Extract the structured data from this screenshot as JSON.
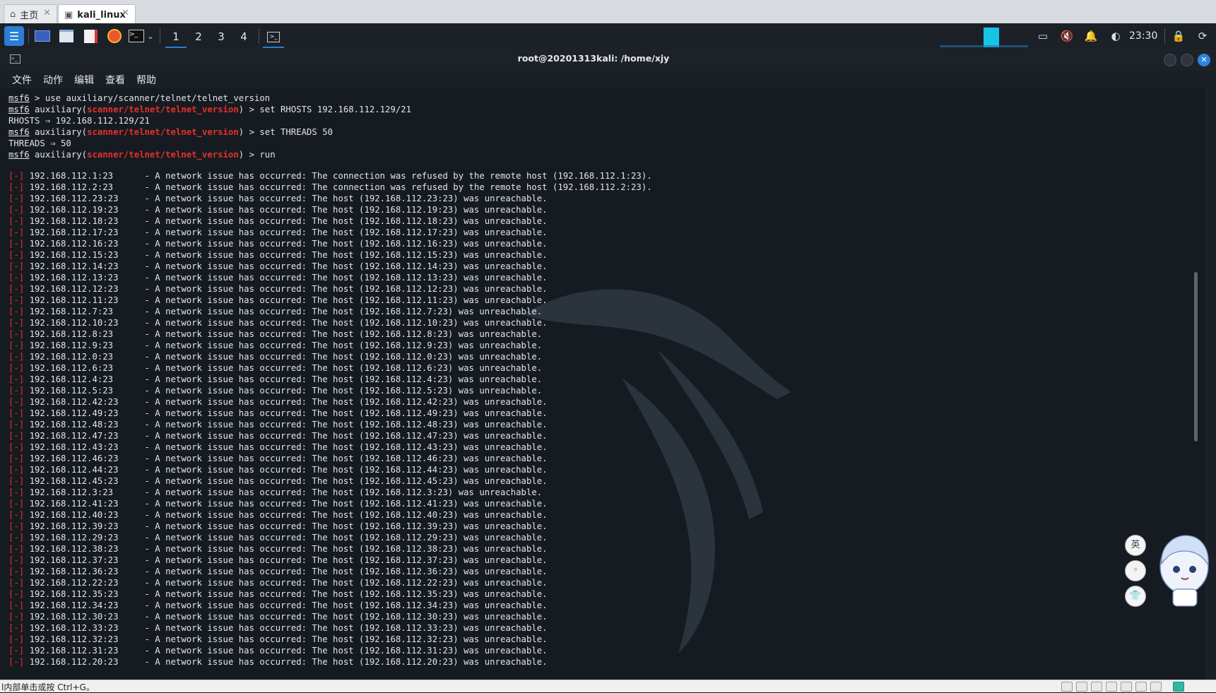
{
  "host_tabs": [
    {
      "label": "主页",
      "icon": "home-icon"
    },
    {
      "label": "kali_linux",
      "icon": "vm-icon"
    }
  ],
  "panel": {
    "workspaces": [
      "1",
      "2",
      "3",
      "4"
    ],
    "clock": "23:30"
  },
  "window": {
    "title": "root@20201313kali: /home/xjy",
    "menu": [
      "文件",
      "动作",
      "编辑",
      "查看",
      "帮助"
    ]
  },
  "terminal": {
    "prompt": "msf6",
    "module": "scanner/telnet/telnet_version",
    "commands": [
      {
        "type": "cmd",
        "text": " > use auxiliary/scanner/telnet/telnet_version"
      },
      {
        "type": "modcmd",
        "text": " > set RHOSTS 192.168.112.129/21"
      },
      {
        "type": "out",
        "text": "RHOSTS ⇒ 192.168.112.129/21"
      },
      {
        "type": "modcmd",
        "text": " > set THREADS 50"
      },
      {
        "type": "out",
        "text": "THREADS ⇒ 50"
      },
      {
        "type": "modcmd",
        "text": " > run"
      }
    ],
    "error_tag": "[-]",
    "results": [
      {
        "host": "192.168.112.1:23",
        "msg": "The connection was refused by the remote host (192.168.112.1:23)."
      },
      {
        "host": "192.168.112.2:23",
        "msg": "The connection was refused by the remote host (192.168.112.2:23)."
      },
      {
        "host": "192.168.112.23:23",
        "msg": "The host (192.168.112.23:23) was unreachable."
      },
      {
        "host": "192.168.112.19:23",
        "msg": "The host (192.168.112.19:23) was unreachable."
      },
      {
        "host": "192.168.112.18:23",
        "msg": "The host (192.168.112.18:23) was unreachable."
      },
      {
        "host": "192.168.112.17:23",
        "msg": "The host (192.168.112.17:23) was unreachable."
      },
      {
        "host": "192.168.112.16:23",
        "msg": "The host (192.168.112.16:23) was unreachable."
      },
      {
        "host": "192.168.112.15:23",
        "msg": "The host (192.168.112.15:23) was unreachable."
      },
      {
        "host": "192.168.112.14:23",
        "msg": "The host (192.168.112.14:23) was unreachable."
      },
      {
        "host": "192.168.112.13:23",
        "msg": "The host (192.168.112.13:23) was unreachable."
      },
      {
        "host": "192.168.112.12:23",
        "msg": "The host (192.168.112.12:23) was unreachable."
      },
      {
        "host": "192.168.112.11:23",
        "msg": "The host (192.168.112.11:23) was unreachable."
      },
      {
        "host": "192.168.112.7:23",
        "msg": "The host (192.168.112.7:23) was unreachable."
      },
      {
        "host": "192.168.112.10:23",
        "msg": "The host (192.168.112.10:23) was unreachable."
      },
      {
        "host": "192.168.112.8:23",
        "msg": "The host (192.168.112.8:23) was unreachable."
      },
      {
        "host": "192.168.112.9:23",
        "msg": "The host (192.168.112.9:23) was unreachable."
      },
      {
        "host": "192.168.112.0:23",
        "msg": "The host (192.168.112.0:23) was unreachable."
      },
      {
        "host": "192.168.112.6:23",
        "msg": "The host (192.168.112.6:23) was unreachable."
      },
      {
        "host": "192.168.112.4:23",
        "msg": "The host (192.168.112.4:23) was unreachable."
      },
      {
        "host": "192.168.112.5:23",
        "msg": "The host (192.168.112.5:23) was unreachable."
      },
      {
        "host": "192.168.112.42:23",
        "msg": "The host (192.168.112.42:23) was unreachable."
      },
      {
        "host": "192.168.112.49:23",
        "msg": "The host (192.168.112.49:23) was unreachable."
      },
      {
        "host": "192.168.112.48:23",
        "msg": "The host (192.168.112.48:23) was unreachable."
      },
      {
        "host": "192.168.112.47:23",
        "msg": "The host (192.168.112.47:23) was unreachable."
      },
      {
        "host": "192.168.112.43:23",
        "msg": "The host (192.168.112.43:23) was unreachable."
      },
      {
        "host": "192.168.112.46:23",
        "msg": "The host (192.168.112.46:23) was unreachable."
      },
      {
        "host": "192.168.112.44:23",
        "msg": "The host (192.168.112.44:23) was unreachable."
      },
      {
        "host": "192.168.112.45:23",
        "msg": "The host (192.168.112.45:23) was unreachable."
      },
      {
        "host": "192.168.112.3:23",
        "msg": "The host (192.168.112.3:23) was unreachable."
      },
      {
        "host": "192.168.112.41:23",
        "msg": "The host (192.168.112.41:23) was unreachable."
      },
      {
        "host": "192.168.112.40:23",
        "msg": "The host (192.168.112.40:23) was unreachable."
      },
      {
        "host": "192.168.112.39:23",
        "msg": "The host (192.168.112.39:23) was unreachable."
      },
      {
        "host": "192.168.112.29:23",
        "msg": "The host (192.168.112.29:23) was unreachable."
      },
      {
        "host": "192.168.112.38:23",
        "msg": "The host (192.168.112.38:23) was unreachable."
      },
      {
        "host": "192.168.112.37:23",
        "msg": "The host (192.168.112.37:23) was unreachable."
      },
      {
        "host": "192.168.112.36:23",
        "msg": "The host (192.168.112.36:23) was unreachable."
      },
      {
        "host": "192.168.112.22:23",
        "msg": "The host (192.168.112.22:23) was unreachable."
      },
      {
        "host": "192.168.112.35:23",
        "msg": "The host (192.168.112.35:23) was unreachable."
      },
      {
        "host": "192.168.112.34:23",
        "msg": "The host (192.168.112.34:23) was unreachable."
      },
      {
        "host": "192.168.112.30:23",
        "msg": "The host (192.168.112.30:23) was unreachable."
      },
      {
        "host": "192.168.112.33:23",
        "msg": "The host (192.168.112.33:23) was unreachable."
      },
      {
        "host": "192.168.112.32:23",
        "msg": "The host (192.168.112.32:23) was unreachable."
      },
      {
        "host": "192.168.112.31:23",
        "msg": "The host (192.168.112.31:23) was unreachable."
      },
      {
        "host": "192.168.112.20:23",
        "msg": "The host (192.168.112.20:23) was unreachable."
      }
    ],
    "msg_prefix": "- A network issue has occurred: "
  },
  "mascot": {
    "buttons": [
      "英",
      "◦",
      "👕"
    ]
  },
  "statusbar": {
    "text": "l内部单击或按 Ctrl+G。"
  },
  "colors": {
    "accent": "#2a7ed6",
    "error_red": "#e5302a",
    "terminal_bg": "#161b21"
  }
}
